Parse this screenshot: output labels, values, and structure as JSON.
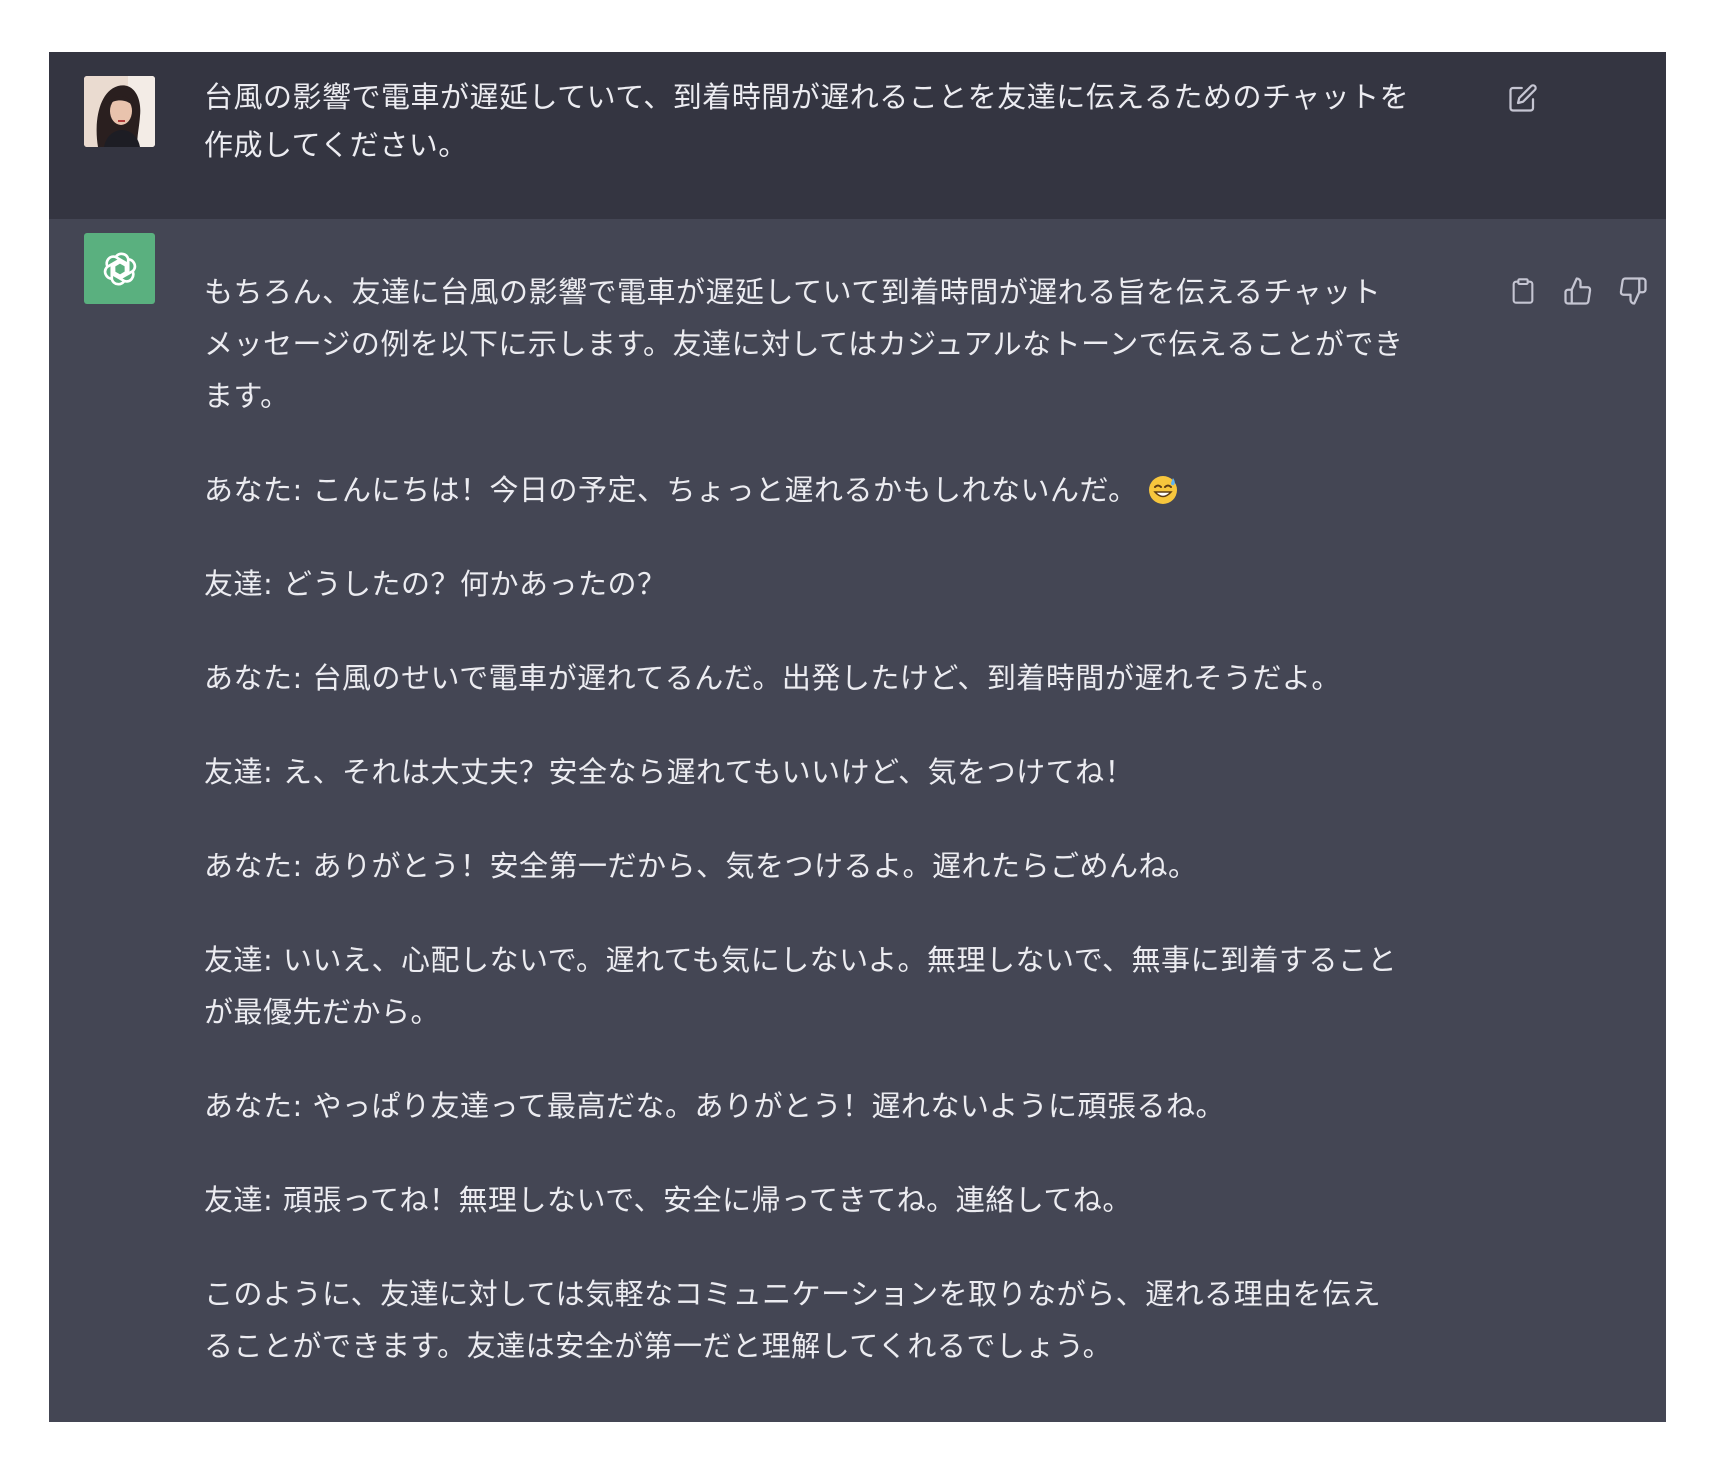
{
  "conversation": {
    "user": {
      "avatar_icon": "user-avatar-photo",
      "message": "台風の影響で電車が遅延していて、到着時間が遅れることを友達に伝えるためのチャットを\n作成してください。",
      "edit_icon": "edit-icon"
    },
    "assistant": {
      "avatar_icon": "openai-logo-icon",
      "paragraphs": [
        "もちろん、友達に台風の影響で電車が遅延していて到着時間が遅れる旨を伝えるチャット\nメッセージの例を以下に示します。友達に対してはカジュアルなトーンで伝えることができ\nます。",
        "あなた: こんにちは！今日の予定、ちょっと遅れるかもしれないんだ。",
        "友達: どうしたの？何かあったの？",
        "あなた: 台風のせいで電車が遅れてるんだ。出発したけど、到着時間が遅れそうだよ。",
        "友達: え、それは大丈夫？安全なら遅れてもいいけど、気をつけてね！",
        "あなた: ありがとう！安全第一だから、気をつけるよ。遅れたらごめんね。",
        "友達: いいえ、心配しないで。遅れても気にしないよ。無理しないで、無事に到着すること\nが最優先だから。",
        "あなた: やっぱり友達って最高だな。ありがとう！遅れないように頑張るね。",
        "友達: 頑張ってね！無理しないで、安全に帰ってきてね。連絡してね。",
        "このように、友達に対しては気軽なコミュニケーションを取りながら、遅れる理由を伝え\nることができます。友達は安全が第一だと理解してくれるでしょう。"
      ],
      "emoji_icon": "grinning-sweat-emoji",
      "actions": {
        "copy_icon": "clipboard-icon",
        "thumbs_up_icon": "thumbs-up-icon",
        "thumbs_down_icon": "thumbs-down-icon"
      }
    }
  },
  "colors": {
    "user_bg": "#343541",
    "assistant_bg": "#444654",
    "text": "#ececf1",
    "icon": "#c5c5d2",
    "bot_avatar_bg": "#5ab07f"
  }
}
